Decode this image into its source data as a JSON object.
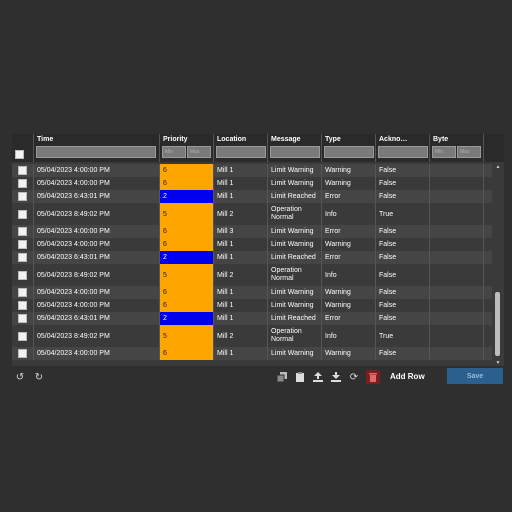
{
  "grid": {
    "columns": [
      {
        "key": "time",
        "label": "Time"
      },
      {
        "key": "priority",
        "label": "Priority",
        "filter_min": "Min",
        "filter_max": "Max"
      },
      {
        "key": "location",
        "label": "Location"
      },
      {
        "key": "message",
        "label": "Message"
      },
      {
        "key": "type",
        "label": "Type"
      },
      {
        "key": "ack",
        "label": "Ackno…"
      },
      {
        "key": "byte",
        "label": "Byte",
        "filter_min": "Min",
        "filter_max": "Max"
      }
    ],
    "rows": [
      {
        "time": "05/04/2023 4:00:00 PM",
        "priority": "6",
        "location": "Mill 1",
        "message": "Limit Warning",
        "type": "Warning",
        "ack": "False",
        "color": "#ffa500"
      },
      {
        "time": "05/04/2023 4:00:00 PM",
        "priority": "6",
        "location": "Mill 1",
        "message": "Limit Warning",
        "type": "Warning",
        "ack": "False",
        "color": "#ffa500"
      },
      {
        "time": "05/04/2023 6:43:01 PM",
        "priority": "2",
        "location": "Mill 1",
        "message": "Limit Reached",
        "type": "Error",
        "ack": "False",
        "color": "#0000ee"
      },
      {
        "time": "05/04/2023 8:49:02 PM",
        "priority": "5",
        "location": "Mill 2",
        "message": "Operation Normal",
        "type": "Info",
        "ack": "True",
        "color": "#ffa500"
      },
      {
        "time": "05/04/2023 4:00:00 PM",
        "priority": "6",
        "location": "Mill 3",
        "message": "Limit Warning",
        "type": "Error",
        "ack": "False",
        "color": "#ffa500"
      },
      {
        "time": "05/04/2023 4:00:00 PM",
        "priority": "6",
        "location": "Mill 1",
        "message": "Limit Warning",
        "type": "Warning",
        "ack": "False",
        "color": "#ffa500"
      },
      {
        "time": "05/04/2023 6:43:01 PM",
        "priority": "2",
        "location": "Mill 1",
        "message": "Limit Reached",
        "type": "Error",
        "ack": "False",
        "color": "#0000ee"
      },
      {
        "time": "05/04/2023 8:49:02 PM",
        "priority": "5",
        "location": "Mill 2",
        "message": "Operation Normal",
        "type": "Info",
        "ack": "False",
        "color": "#ffa500"
      },
      {
        "time": "05/04/2023 4:00:00 PM",
        "priority": "6",
        "location": "Mill 1",
        "message": "Limit Warning",
        "type": "Warning",
        "ack": "False",
        "color": "#ffa500"
      },
      {
        "time": "05/04/2023 4:00:00 PM",
        "priority": "6",
        "location": "Mill 1",
        "message": "Limit Warning",
        "type": "Warning",
        "ack": "False",
        "color": "#ffa500"
      },
      {
        "time": "05/04/2023 6:43:01 PM",
        "priority": "2",
        "location": "Mill 1",
        "message": "Limit Reached",
        "type": "Error",
        "ack": "False",
        "color": "#0000ee"
      },
      {
        "time": "05/04/2023 8:49:02 PM",
        "priority": "5",
        "location": "Mill 2",
        "message": "Operation Normal",
        "type": "Info",
        "ack": "True",
        "color": "#ffa500"
      },
      {
        "time": "05/04/2023 4:00:00 PM",
        "priority": "6",
        "location": "Mill 1",
        "message": "Limit Warning",
        "type": "Warning",
        "ack": "False",
        "color": "#ffa500"
      }
    ]
  },
  "toolbar": {
    "undo_icon": "undo-icon",
    "redo_icon": "redo-icon",
    "add_row_label": "Add Row",
    "save_label": "Save"
  }
}
